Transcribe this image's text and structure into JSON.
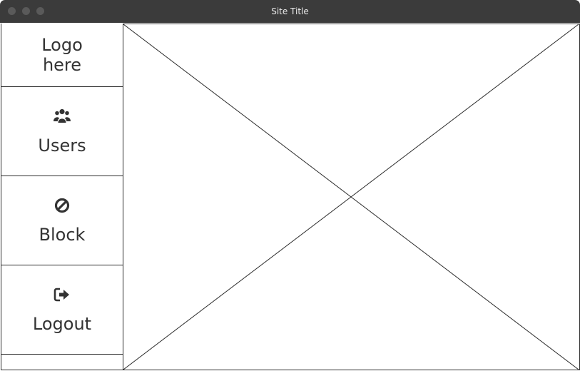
{
  "window": {
    "title": "Site Title"
  },
  "sidebar": {
    "logo_text": "Logo here",
    "items": [
      {
        "label": "Users",
        "icon": "users-icon"
      },
      {
        "label": "Block",
        "icon": "block-icon"
      },
      {
        "label": "Logout",
        "icon": "logout-icon"
      }
    ]
  },
  "main": {
    "content_placeholder": "image-placeholder"
  },
  "colors": {
    "titlebar": "#3b3b3b",
    "border": "#2c2c2c",
    "text": "#333333"
  }
}
